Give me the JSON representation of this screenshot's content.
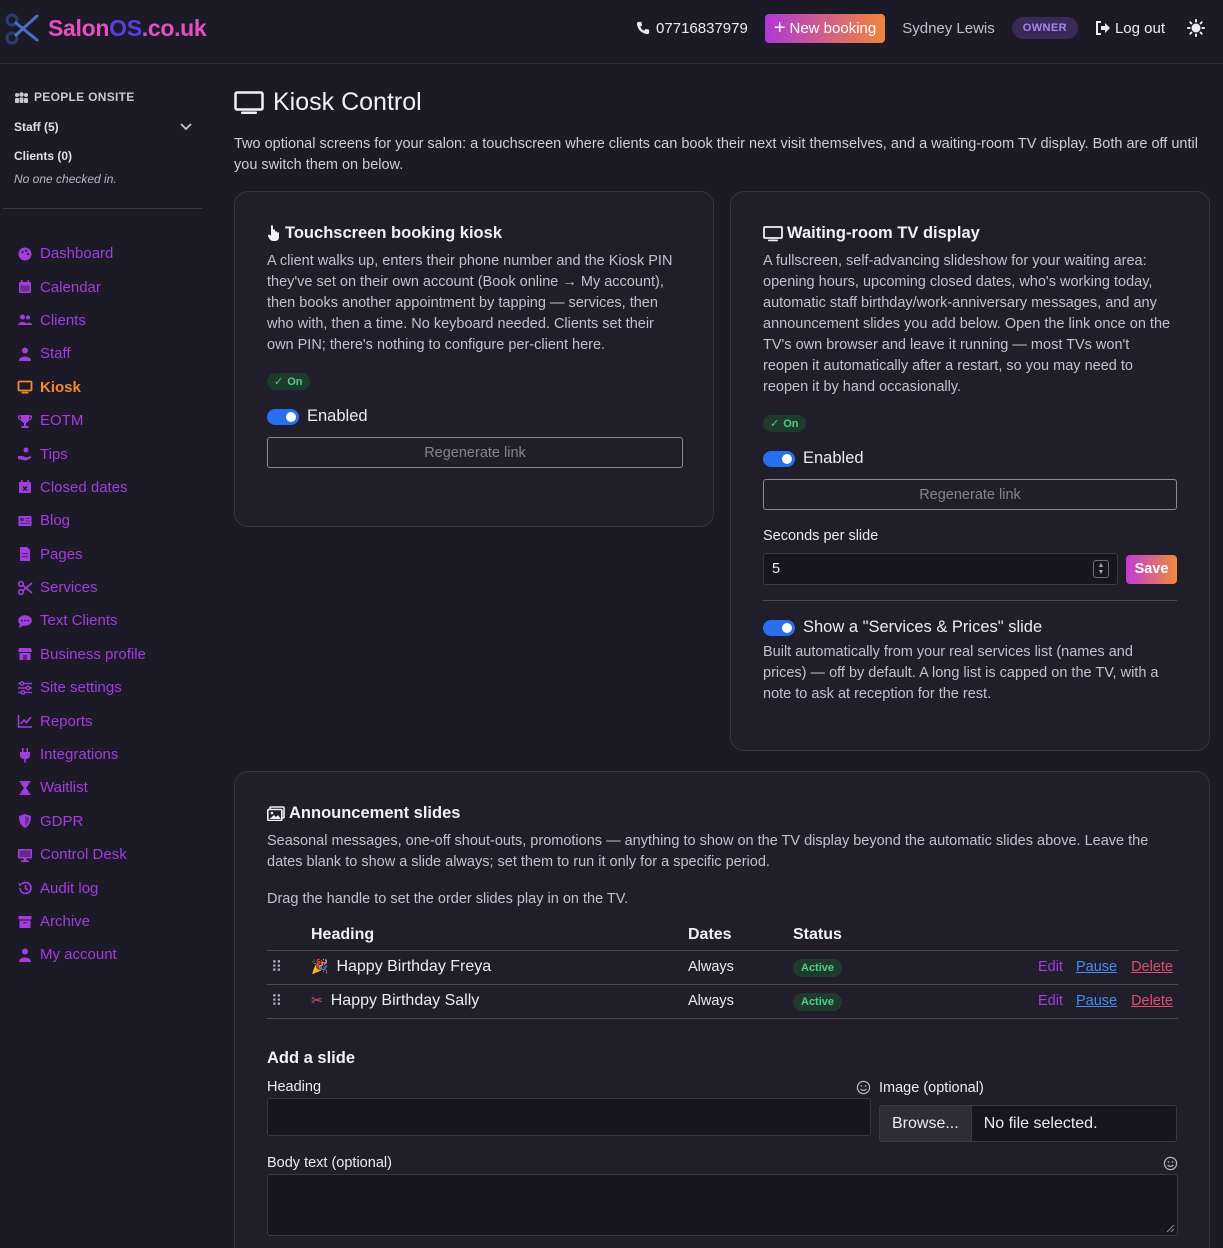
{
  "header": {
    "logo_main": "Salon",
    "logo_os": "OS",
    "logo_tld": ".co.uk",
    "phone": "07716837979",
    "new_booking": "New booking",
    "user_name": "Sydney Lewis",
    "role_badge": "OWNER",
    "logout": "Log out"
  },
  "sidebar": {
    "people_title": "PEOPLE ONSITE",
    "staff_label": "Staff (5)",
    "clients_label": "Clients (0)",
    "no_one": "No one checked in.",
    "items": [
      {
        "label": "Dashboard",
        "icon": "palette-icon"
      },
      {
        "label": "Calendar",
        "icon": "calendar-icon"
      },
      {
        "label": "Clients",
        "icon": "users-icon"
      },
      {
        "label": "Staff",
        "icon": "user-tie-icon"
      },
      {
        "label": "Kiosk",
        "icon": "tv-icon",
        "active": true
      },
      {
        "label": "EOTM",
        "icon": "trophy-icon"
      },
      {
        "label": "Tips",
        "icon": "hand-coin-icon"
      },
      {
        "label": "Closed dates",
        "icon": "calendar-x-icon"
      },
      {
        "label": "Blog",
        "icon": "newspaper-icon"
      },
      {
        "label": "Pages",
        "icon": "file-icon"
      },
      {
        "label": "Services",
        "icon": "scissors-icon"
      },
      {
        "label": "Text Clients",
        "icon": "chat-icon"
      },
      {
        "label": "Business profile",
        "icon": "store-icon"
      },
      {
        "label": "Site settings",
        "icon": "sliders-icon"
      },
      {
        "label": "Reports",
        "icon": "chart-line-icon"
      },
      {
        "label": "Integrations",
        "icon": "plug-icon"
      },
      {
        "label": "Waitlist",
        "icon": "hourglass-icon"
      },
      {
        "label": "GDPR",
        "icon": "shield-icon"
      },
      {
        "label": "Control Desk",
        "icon": "desktop-icon"
      },
      {
        "label": "Audit log",
        "icon": "history-icon"
      },
      {
        "label": "Archive",
        "icon": "archive-icon"
      },
      {
        "label": "My account",
        "icon": "user-icon"
      }
    ]
  },
  "page": {
    "title": "Kiosk Control",
    "intro": "Two optional screens for your salon: a touchscreen where clients can book their next visit themselves, and a waiting-room TV display. Both are off until you switch them on below."
  },
  "kiosk_card": {
    "title": "Touchscreen booking kiosk",
    "desc": "A client walks up, enters their phone number and the Kiosk PIN they've set on their own account (Book online → My account), then books another appointment by tapping — services, then who with, then a time. No keyboard needed. Clients set their own PIN; there's nothing to configure per-client here.",
    "status": "On",
    "toggle_label": "Enabled",
    "regen": "Regenerate link"
  },
  "tv_card": {
    "title": "Waiting-room TV display",
    "desc": "A fullscreen, self-advancing slideshow for your waiting area: opening hours, upcoming closed dates, who's working today, automatic staff birthday/work-anniversary messages, and any announcement slides you add below. Open the link once on the TV's own browser and leave it running — most TVs won't reopen it automatically after a restart, so you may need to reopen it by hand occasionally.",
    "status": "On",
    "toggle_label": "Enabled",
    "regen": "Regenerate link",
    "seconds_label": "Seconds per slide",
    "seconds_value": "5",
    "save": "Save",
    "services_toggle_label": "Show a \"Services & Prices\" slide",
    "services_desc": "Built automatically from your real services list (names and prices) — off by default. A long list is capped on the TV, with a note to ask at reception for the rest."
  },
  "announcements": {
    "title": "Announcement slides",
    "desc": "Seasonal messages, one-off shout-outs, promotions — anything to show on the TV display beyond the automatic slides above. Leave the dates blank to show a slide always; set them to run it only for a specific period.",
    "drag_hint": "Drag the handle to set the order slides play in on the TV.",
    "columns": [
      "Heading",
      "Dates",
      "Status"
    ],
    "rows": [
      {
        "emoji": "🎉",
        "heading": "Happy Birthday Freya",
        "dates": "Always",
        "status": "Active",
        "edit": "Edit",
        "pause": "Pause",
        "delete": "Delete"
      },
      {
        "emoji": "✂",
        "heading": "Happy Birthday Sally",
        "dates": "Always",
        "status": "Active",
        "edit": "Edit",
        "pause": "Pause",
        "delete": "Delete"
      }
    ],
    "add_title": "Add a slide",
    "heading_label": "Heading",
    "image_label": "Image (optional)",
    "browse": "Browse...",
    "no_file": "No file selected.",
    "body_label": "Body text (optional)"
  }
}
